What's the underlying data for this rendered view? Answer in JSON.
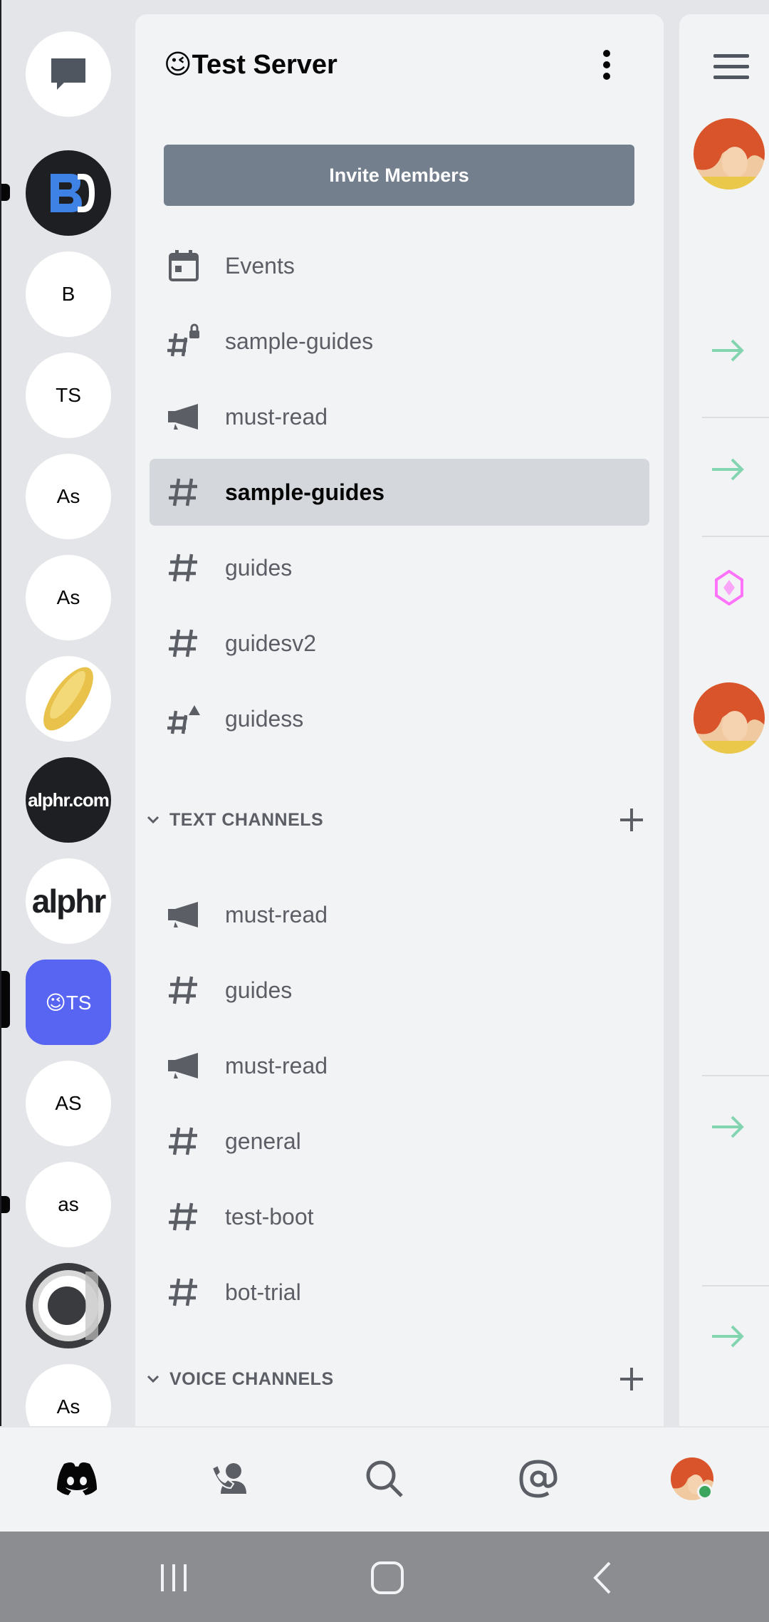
{
  "server": {
    "name": "😉Test Server",
    "invite_label": "Invite Members"
  },
  "rail": {
    "servers": [
      {
        "label": ""
      },
      {
        "label": "B"
      },
      {
        "label": "TS"
      },
      {
        "label": "As"
      },
      {
        "label": "As"
      },
      {
        "label": ""
      },
      {
        "label": "alphr.com"
      },
      {
        "label": "alphr"
      },
      {
        "label": "😉TS"
      },
      {
        "label": "AS"
      },
      {
        "label": "as"
      },
      {
        "label": ""
      },
      {
        "label": "As"
      }
    ]
  },
  "channels": {
    "top": [
      {
        "label": "Events",
        "icon": "calendar-icon"
      },
      {
        "label": "sample-guides",
        "icon": "locked-hashtag-icon"
      },
      {
        "label": "must-read",
        "icon": "megaphone-icon"
      },
      {
        "label": "sample-guides",
        "icon": "hashtag-icon"
      },
      {
        "label": "guides",
        "icon": "hashtag-icon"
      },
      {
        "label": "guidesv2",
        "icon": "hashtag-icon"
      },
      {
        "label": "guidess",
        "icon": "warning-hashtag-icon"
      }
    ],
    "text_category": "TEXT CHANNELS",
    "text": [
      {
        "label": "must-read",
        "icon": "megaphone-icon"
      },
      {
        "label": "guides",
        "icon": "hashtag-icon"
      },
      {
        "label": "must-read",
        "icon": "megaphone-icon"
      },
      {
        "label": "general",
        "icon": "hashtag-icon"
      },
      {
        "label": "test-boot",
        "icon": "hashtag-icon"
      },
      {
        "label": "bot-trial",
        "icon": "hashtag-icon"
      }
    ],
    "voice_category": "VOICE CHANNELS"
  },
  "colors": {
    "blurple": "#5865f2",
    "invite_button": "#747f8d",
    "arrow_green": "#83d4b0",
    "online_green": "#3ba55d"
  }
}
